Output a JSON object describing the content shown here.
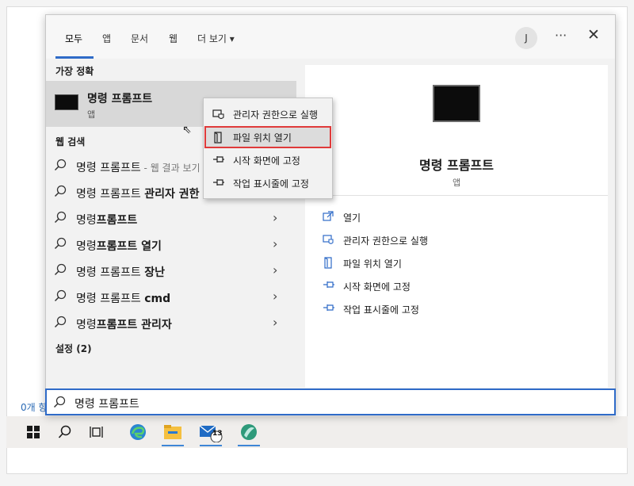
{
  "tabs": [
    {
      "label": "모두"
    },
    {
      "label": "앱"
    },
    {
      "label": "문서"
    },
    {
      "label": "웹"
    },
    {
      "label": "더 보기"
    }
  ],
  "user": {
    "initial": "J"
  },
  "more_label": "···",
  "close_label": "✕",
  "best_match": {
    "section": "가장 정확",
    "title": "명령 프롬프트",
    "subtitle": "앱"
  },
  "web_search": {
    "section": "웹 검색",
    "items": [
      {
        "prefix": "명령 프롬프트",
        "bold": "",
        "suffix": " - 웹 결과 보기"
      },
      {
        "prefix": "명령 프롬프트 ",
        "bold": "관리자 권한",
        "suffix": ""
      },
      {
        "prefix": "명령",
        "bold": "프롬프트",
        "suffix": ""
      },
      {
        "prefix": "명령",
        "bold": "프롬프트 열기",
        "suffix": ""
      },
      {
        "prefix": "명령 프롬프트 ",
        "bold": "장난",
        "suffix": ""
      },
      {
        "prefix": "명령 프롬프트 ",
        "bold": "cmd",
        "suffix": ""
      },
      {
        "prefix": "명령",
        "bold": "프롬프트 관리자",
        "suffix": ""
      }
    ]
  },
  "settings_section": "설정 (2)",
  "context_menu": {
    "items": [
      {
        "label": "관리자 권한으로 실행",
        "icon": "shield-icon"
      },
      {
        "label": "파일 위치 열기",
        "icon": "file-location-icon"
      },
      {
        "label": "시작 화면에 고정",
        "icon": "pin-icon"
      },
      {
        "label": "작업 표시줄에 고정",
        "icon": "pin-icon"
      }
    ]
  },
  "right_panel": {
    "title": "명령 프롬프트",
    "subtitle": "앱",
    "actions": [
      {
        "label": "열기",
        "icon": "open-icon"
      },
      {
        "label": "관리자 권한으로 실행",
        "icon": "shield-icon"
      },
      {
        "label": "파일 위치 열기",
        "icon": "file-location-icon"
      },
      {
        "label": "시작 화면에 고정",
        "icon": "pin-icon"
      },
      {
        "label": "작업 표시줄에 고정",
        "icon": "pin-icon"
      }
    ]
  },
  "search": {
    "value": "명령 프롬프트"
  },
  "desktop_text": "0개 항",
  "taskbar": {
    "mail_badge": "13"
  },
  "colors": {
    "accent": "#2f6bc8",
    "highlight_border": "#e03a3a"
  }
}
